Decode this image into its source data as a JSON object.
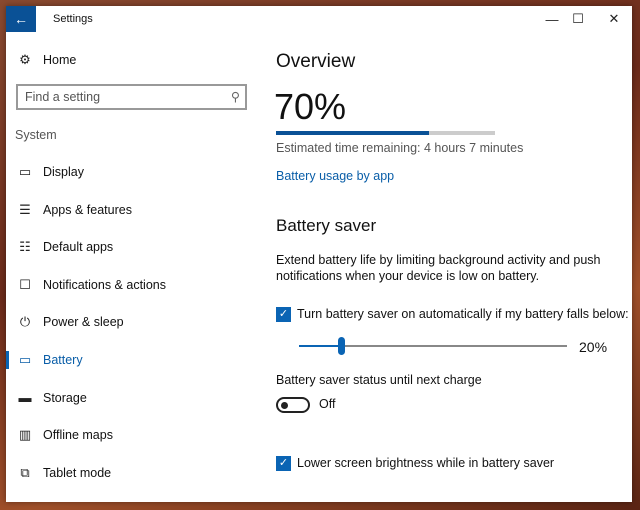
{
  "window": {
    "title": "Settings",
    "back_icon": "arrow-left-icon",
    "minimize": "—",
    "maximize": "☐",
    "close": "✕"
  },
  "sidebar": {
    "home": "Home",
    "search_placeholder": "Find a setting",
    "section": "System",
    "items": [
      {
        "label": "Display",
        "icon": "monitor-icon",
        "glyph": "▭"
      },
      {
        "label": "Apps & features",
        "icon": "list-icon",
        "glyph": "☰"
      },
      {
        "label": "Default apps",
        "icon": "default-apps-icon",
        "glyph": "☷"
      },
      {
        "label": "Notifications & actions",
        "icon": "message-icon",
        "glyph": "☐"
      },
      {
        "label": "Power & sleep",
        "icon": "power-icon",
        "glyph": "⏻"
      },
      {
        "label": "Battery",
        "icon": "battery-icon",
        "glyph": "▭",
        "active": true
      },
      {
        "label": "Storage",
        "icon": "storage-icon",
        "glyph": "▬"
      },
      {
        "label": "Offline maps",
        "icon": "map-icon",
        "glyph": "▥"
      },
      {
        "label": "Tablet mode",
        "icon": "tablet-icon",
        "glyph": "⧉"
      }
    ]
  },
  "main": {
    "overview_title": "Overview",
    "percent": "70%",
    "battery_level": 70,
    "estimate": "Estimated time remaining: 4 hours 7 minutes",
    "usage_link": "Battery usage by app",
    "saver_title": "Battery saver",
    "saver_desc_1": "Extend battery life by limiting background activity and push",
    "saver_desc_2": "notifications when your device is low on battery.",
    "auto_label": "Turn battery saver on automatically if my battery falls below:",
    "auto_checked": true,
    "slider_value": 20,
    "slider_label": "20%",
    "status_label": "Battery saver status until next charge",
    "toggle_state": "Off",
    "brightness_label": "Lower screen brightness while in battery saver",
    "brightness_checked": true
  },
  "colors": {
    "accent": "#0a64b4",
    "titlebar_back": "#0a5196"
  }
}
